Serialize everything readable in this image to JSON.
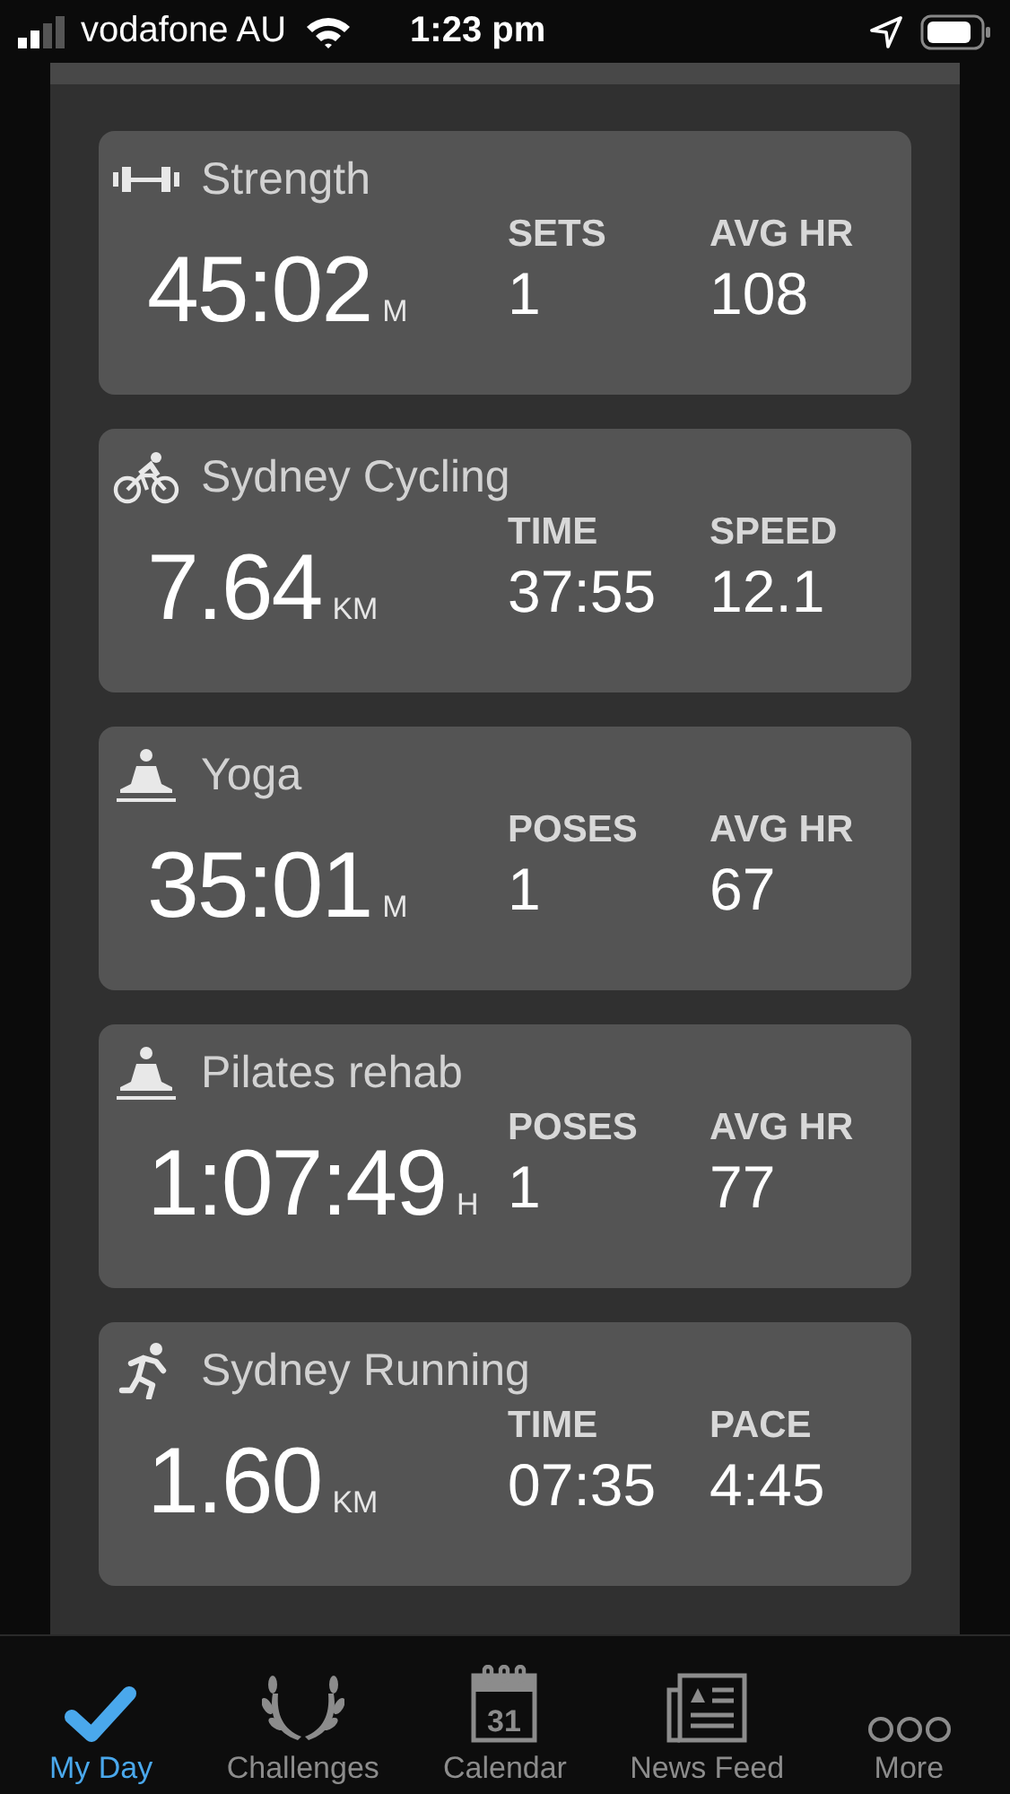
{
  "status_bar": {
    "carrier": "vodafone AU",
    "time": "1:23 pm"
  },
  "activities": [
    {
      "kind": "strength",
      "title": "Strength",
      "value": "45:02",
      "unit": "M",
      "stats": [
        {
          "label": "SETS",
          "value": "1"
        },
        {
          "label": "AVG HR",
          "value": "108"
        }
      ]
    },
    {
      "kind": "cycling",
      "title": "Sydney Cycling",
      "value": "7.64",
      "unit": "KM",
      "stats": [
        {
          "label": "TIME",
          "value": "37:55"
        },
        {
          "label": "SPEED",
          "value": "12.1"
        }
      ]
    },
    {
      "kind": "yoga",
      "title": "Yoga",
      "value": "35:01",
      "unit": "M",
      "stats": [
        {
          "label": "POSES",
          "value": "1"
        },
        {
          "label": "AVG HR",
          "value": "67"
        }
      ]
    },
    {
      "kind": "yoga",
      "title": "Pilates rehab",
      "value": "1:07:49",
      "unit": "H",
      "stats": [
        {
          "label": "POSES",
          "value": "1"
        },
        {
          "label": "AVG HR",
          "value": "77"
        }
      ]
    },
    {
      "kind": "running",
      "title": "Sydney Running",
      "value": "1.60",
      "unit": "KM",
      "stats": [
        {
          "label": "TIME",
          "value": "07:35"
        },
        {
          "label": "PACE",
          "value": "4:45"
        }
      ]
    }
  ],
  "tab_bar": [
    {
      "kind": "myday",
      "label": "My Day",
      "selected": true
    },
    {
      "kind": "challenges",
      "label": "Challenges",
      "selected": false
    },
    {
      "kind": "calendar",
      "label": "Calendar",
      "selected": false,
      "icon_text": "31"
    },
    {
      "kind": "news",
      "label": "News Feed",
      "selected": false
    },
    {
      "kind": "more",
      "label": "More",
      "selected": false
    }
  ]
}
